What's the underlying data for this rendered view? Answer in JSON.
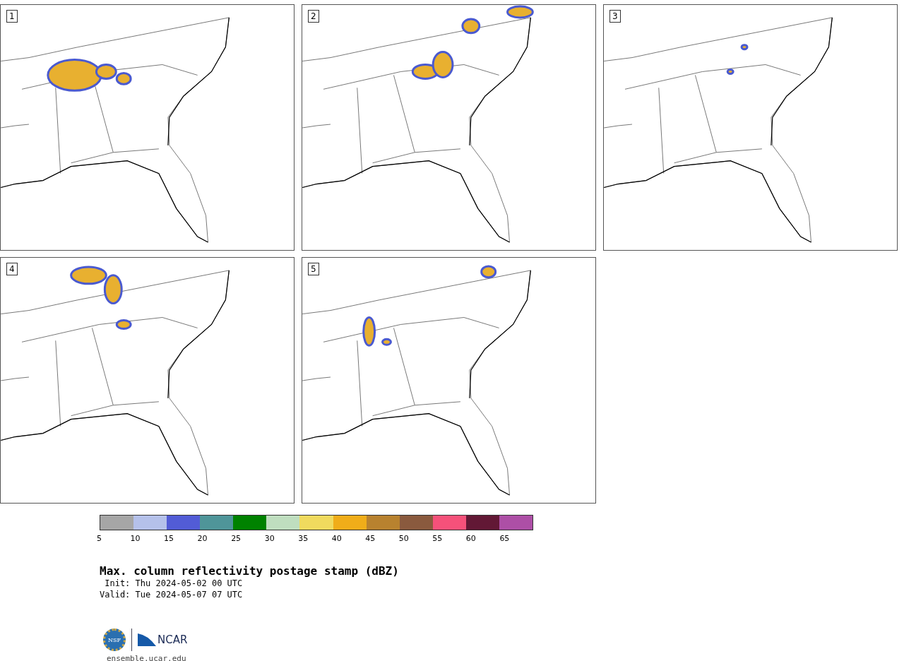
{
  "panels": [
    {
      "label": "1"
    },
    {
      "label": "2"
    },
    {
      "label": "3"
    },
    {
      "label": "4"
    },
    {
      "label": "5"
    }
  ],
  "colorbar": {
    "segments": [
      {
        "label": "5",
        "color": "#a6a6a6"
      },
      {
        "label": "10",
        "color": "#b5c1ea"
      },
      {
        "label": "15",
        "color": "#525cd6"
      },
      {
        "label": "20",
        "color": "#4f9599"
      },
      {
        "label": "25",
        "color": "#008200"
      },
      {
        "label": "30",
        "color": "#bfdebf"
      },
      {
        "label": "35",
        "color": "#f0da5e"
      },
      {
        "label": "40",
        "color": "#f0ad19"
      },
      {
        "label": "45",
        "color": "#b8822f"
      },
      {
        "label": "50",
        "color": "#8a5a3e"
      },
      {
        "label": "55",
        "color": "#f5517a"
      },
      {
        "label": "60",
        "color": "#621835"
      },
      {
        "label": "65",
        "color": "#ad4fa6"
      }
    ]
  },
  "title": "Max. column reflectivity postage stamp (dBZ)",
  "init": " Init: Thu 2024-05-02 00 UTC",
  "valid": "Valid: Tue 2024-05-07 07 UTC",
  "logo": {
    "nsf": "NSF",
    "ncar": "NCAR"
  },
  "url": "ensemble.ucar.edu"
}
